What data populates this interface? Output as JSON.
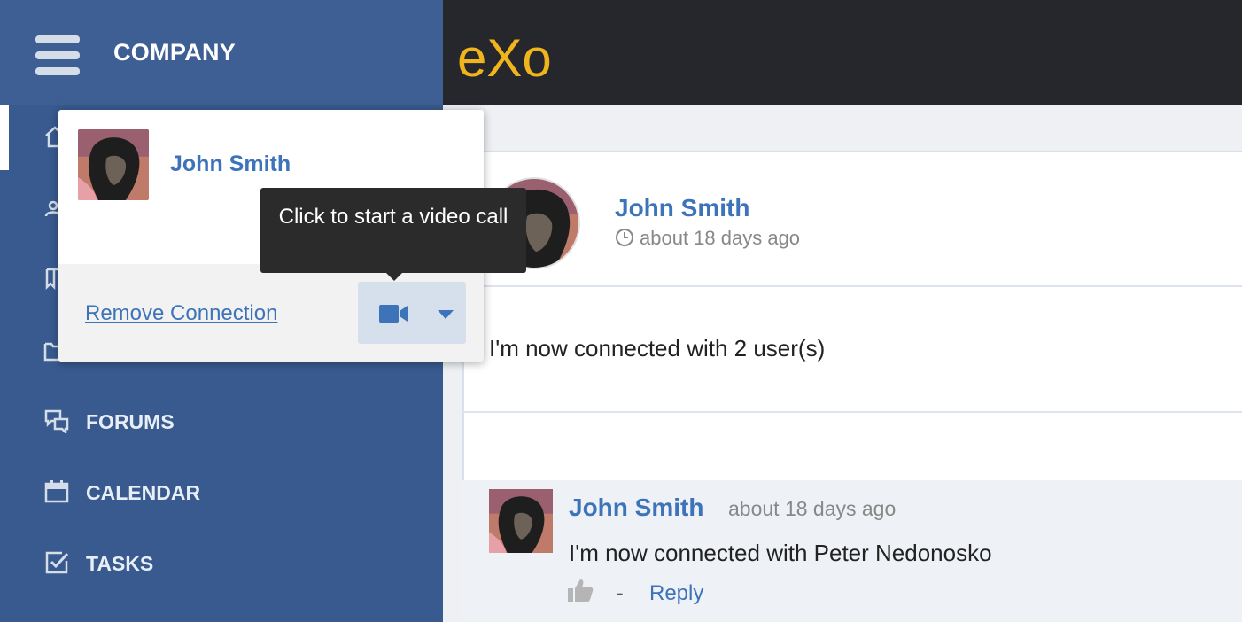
{
  "sidebar": {
    "title": "COMPANY",
    "items": [
      {
        "label": "FORUMS",
        "icon": "forums-icon"
      },
      {
        "label": "CALENDAR",
        "icon": "calendar-icon"
      },
      {
        "label": "TASKS",
        "icon": "tasks-icon"
      }
    ]
  },
  "topbar": {
    "logo_text": "eXo"
  },
  "popup": {
    "name": "John Smith",
    "remove_label": "Remove Connection",
    "tooltip": "Click to start a video call"
  },
  "post": {
    "author": "John Smith",
    "time": "about 18 days ago",
    "body": "I'm now connected with 2 user(s)"
  },
  "comment": {
    "author": "John Smith",
    "time": "about 18 days ago",
    "text": "I'm now connected with Peter Nedonosko",
    "dash": "-",
    "reply_label": "Reply"
  },
  "colors": {
    "sidebar": "#385a8e",
    "topbar": "#25272c",
    "link": "#3d73b9",
    "logo_yellow": "#f0b41c"
  }
}
